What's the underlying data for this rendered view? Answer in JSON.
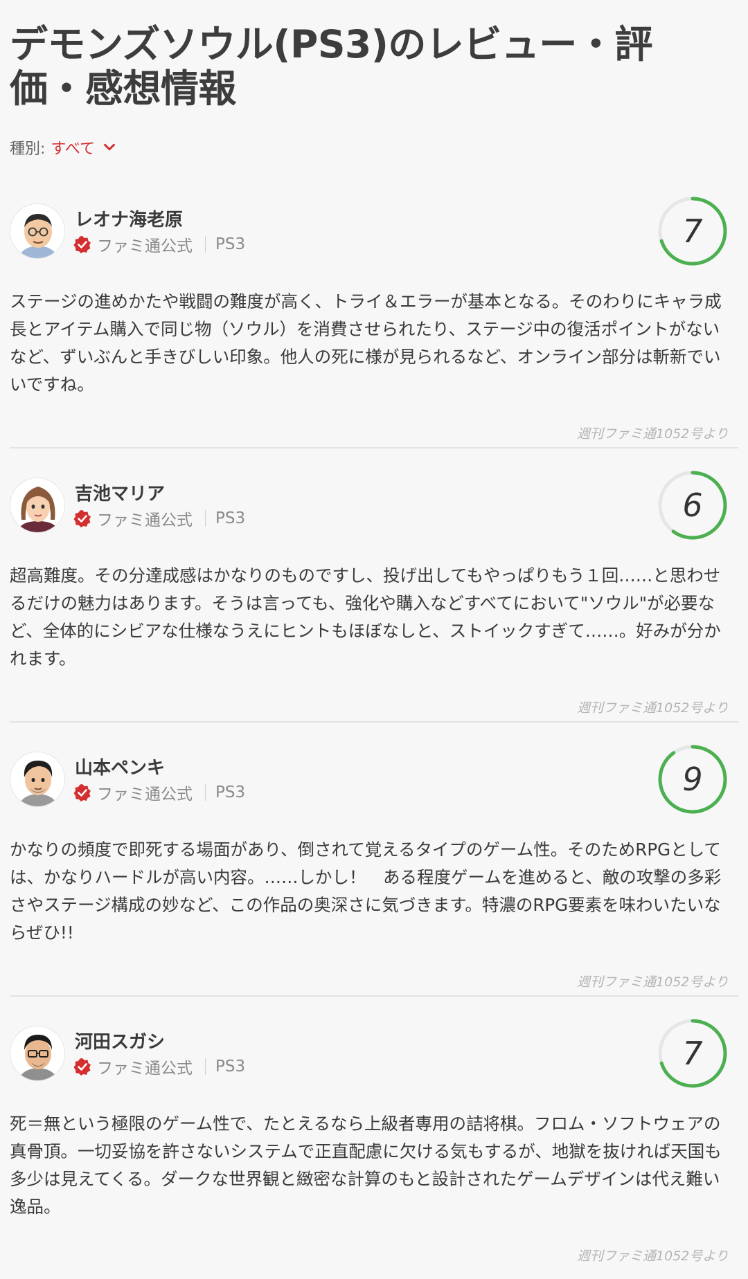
{
  "page": {
    "title": "デモンズソウル(PS3)のレビュー・評価・感想情報",
    "filter_label": "種別:",
    "filter_value": "すべて"
  },
  "colors": {
    "accent_red": "#d32f2f",
    "score_green": "#4caf50",
    "score_track": "#e6e6e6"
  },
  "reviews": [
    {
      "reviewer": "レオナ海老原",
      "badge": "ファミ通公式",
      "platform": "PS3",
      "score": 7,
      "score_max": 10,
      "comment": "ステージの進めかたや戦闘の難度が高く、トライ＆エラーが基本となる。そのわりにキャラ成長とアイテム購入で同じ物（ソウル）を消費させられたり、ステージ中の復活ポイントがないなど、ずいぶんと手きびしい印象。他人の死に様が見られるなど、オンライン部分は斬新でいいですね。",
      "source": "週刊ファミ通1052号より"
    },
    {
      "reviewer": "吉池マリア",
      "badge": "ファミ通公式",
      "platform": "PS3",
      "score": 6,
      "score_max": 10,
      "comment": "超高難度。その分達成感はかなりのものですし、投げ出してもやっぱりもう１回……と思わせるだけの魅力はあります。そうは言っても、強化や購入などすべてにおいて\"ソウル\"が必要など、全体的にシビアな仕様なうえにヒントもほぼなしと、ストイックすぎて……。好みが分かれます。",
      "source": "週刊ファミ通1052号より"
    },
    {
      "reviewer": "山本ペンキ",
      "badge": "ファミ通公式",
      "platform": "PS3",
      "score": 9,
      "score_max": 10,
      "comment": "かなりの頻度で即死する場面があり、倒されて覚えるタイプのゲーム性。そのためRPGとしては、かなりハードルが高い内容。……しかし！　ある程度ゲームを進めると、敵の攻撃の多彩さやステージ構成の妙など、この作品の奥深さに気づきます。特濃のRPG要素を味わいたいならぜひ!!",
      "source": "週刊ファミ通1052号より"
    },
    {
      "reviewer": "河田スガシ",
      "badge": "ファミ通公式",
      "platform": "PS3",
      "score": 7,
      "score_max": 10,
      "comment": "死＝無という極限のゲーム性で、たとえるなら上級者専用の詰将棋。フロム・ソフトウェアの真骨頂。一切妥協を許さないシステムで正直配慮に欠ける気もするが、地獄を抜ければ天国も多少は見えてくる。ダークな世界観と緻密な計算のもと設計されたゲームデザインは代え難い逸品。",
      "source": "週刊ファミ通1052号より"
    }
  ]
}
